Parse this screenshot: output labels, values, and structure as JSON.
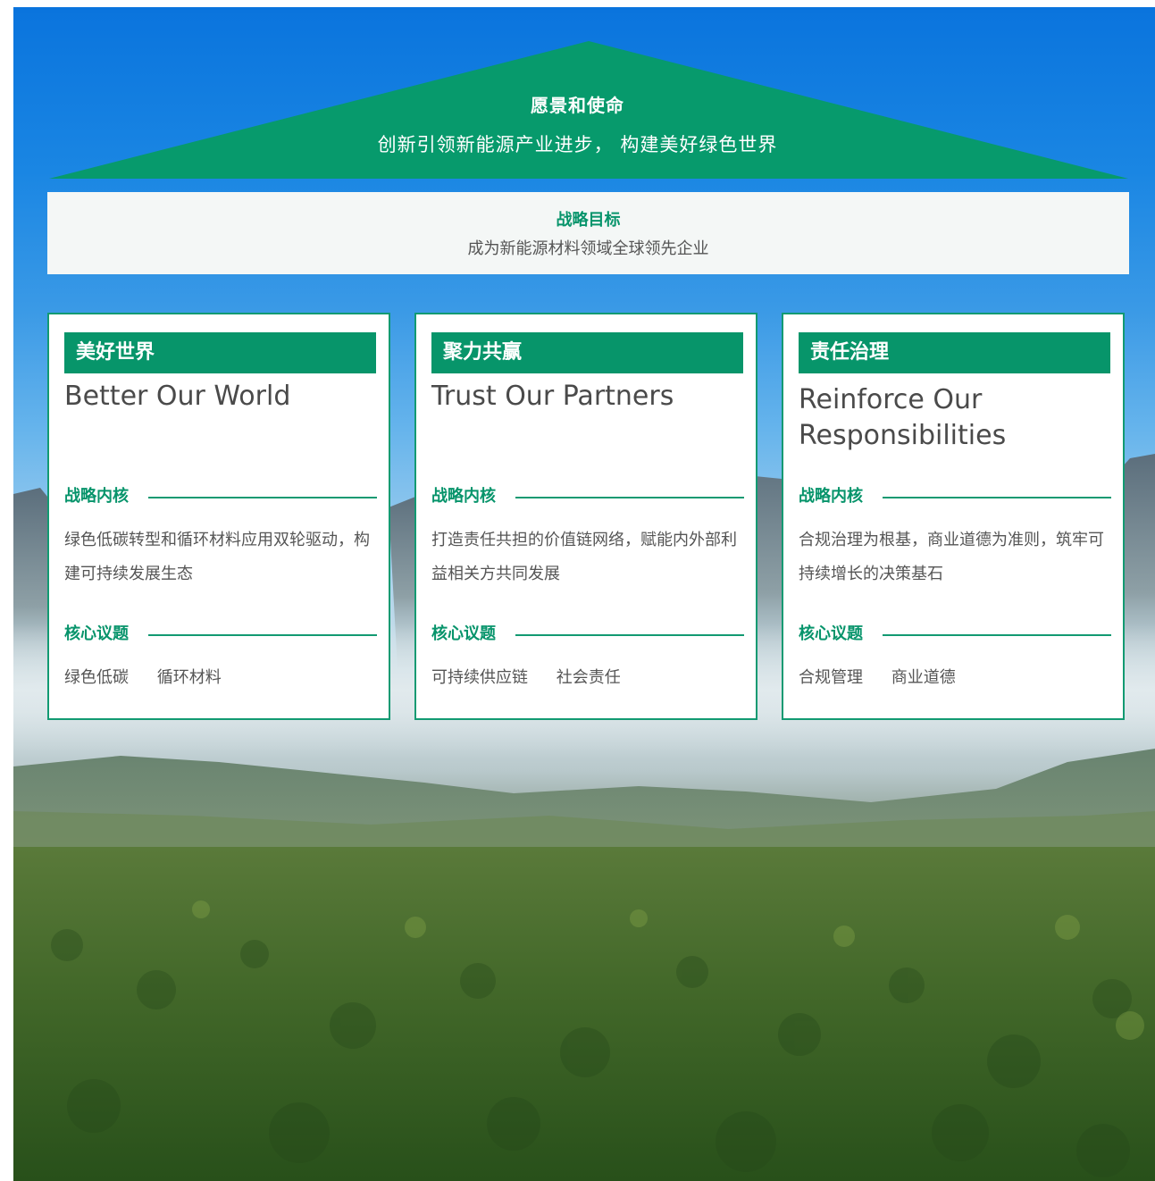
{
  "vision": {
    "title": "愿景和使命",
    "subtitle": "创新引领新能源产业进步， 构建美好绿色世界"
  },
  "goal": {
    "title": "战略目标",
    "text": "成为新能源材料领域全球领先企业"
  },
  "cards": [
    {
      "heading": "美好世界",
      "english": "Better Our World",
      "core_label": "战略内核",
      "core_text": "绿色低碳转型和循环材料应用双轮驱动，构建可持续发展生态",
      "topics_label": "核心议题",
      "topics": [
        "绿色低碳",
        "循环材料"
      ]
    },
    {
      "heading": "聚力共赢",
      "english": "Trust Our Partners",
      "core_label": "战略内核",
      "core_text": "打造责任共担的价值链网络，赋能内外部利益相关方共同发展",
      "topics_label": "核心议题",
      "topics": [
        "可持续供应链",
        "社会责任"
      ]
    },
    {
      "heading": "责任治理",
      "english": "Reinforce Our Responsibilities",
      "core_label": "战略内核",
      "core_text": "合规治理为根基，商业道德为准则，筑牢可持续增长的决策基石",
      "topics_label": "核心议题",
      "topics": [
        "合规管理",
        "商业道德"
      ]
    }
  ],
  "colors": {
    "brand_green": "#07956a",
    "sky_blue": "#0a74dd",
    "forest_green": "#3f6a24"
  }
}
